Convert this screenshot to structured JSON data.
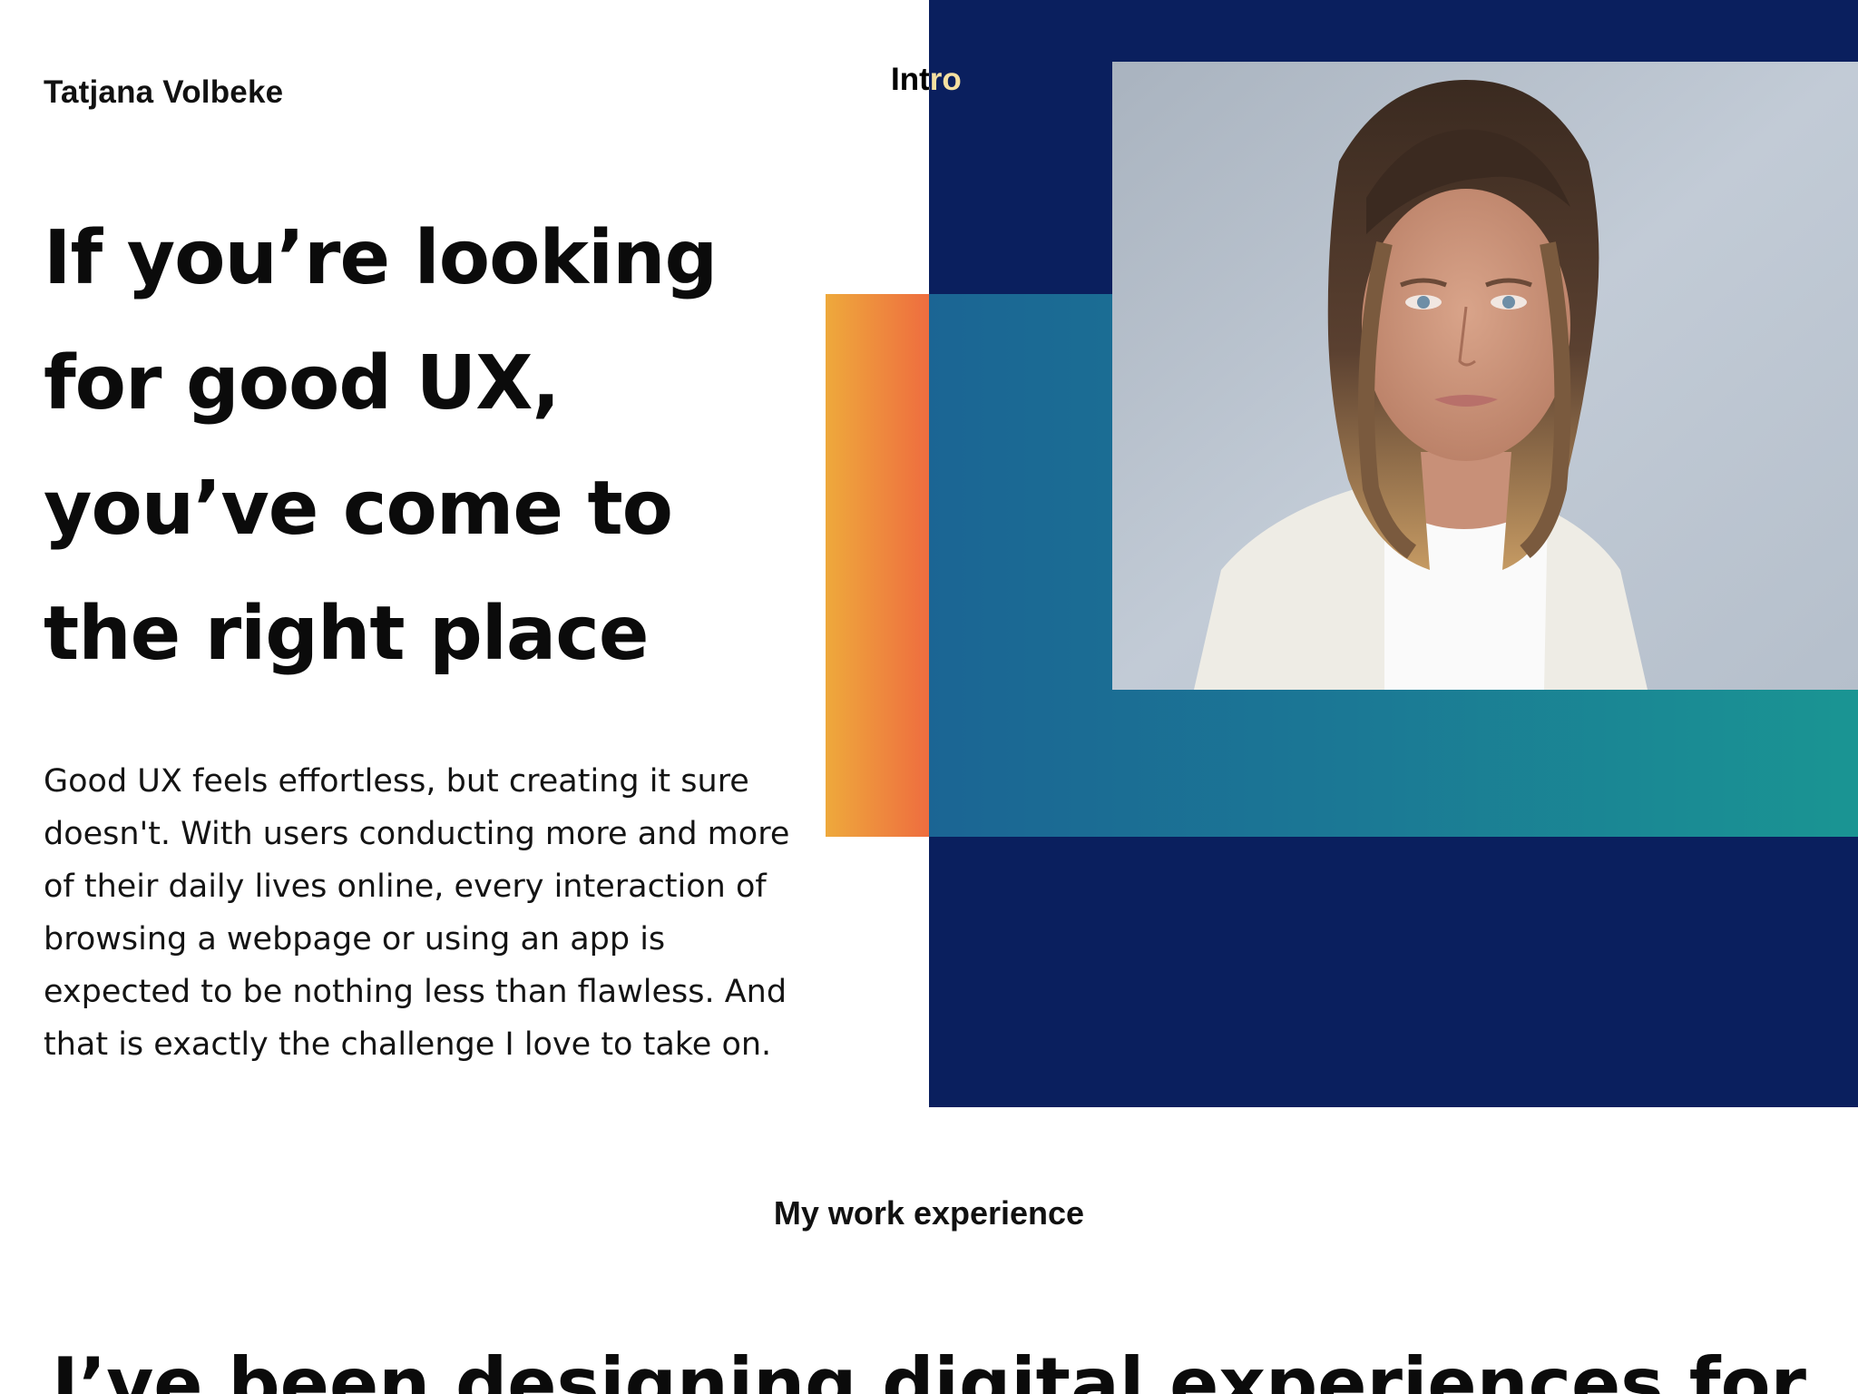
{
  "header": {
    "brand_name": "Tatjana Volbeke",
    "nav_intro": "Intro"
  },
  "hero": {
    "headline": "If you’re looking for good UX,  you’ve come to the right place",
    "body": "Good UX feels effortless, but creating it sure doesn't. With users conducting more and more of their daily lives online, every interaction of browsing a webpage or using an app is expected to be nothing less than flawless. And that is exactly the challenge I love to take on.",
    "portrait_alt": "Portrait of Tatjana Volbeke"
  },
  "work": {
    "label": "My work experience",
    "headline": "I’ve been designing digital experiences for"
  },
  "colors": {
    "navy": "#0a1f5e",
    "teal_start": "#1b6594",
    "teal_end": "#1a9593",
    "orange_start": "#eea93c",
    "orange_end": "#ee6d3f"
  }
}
